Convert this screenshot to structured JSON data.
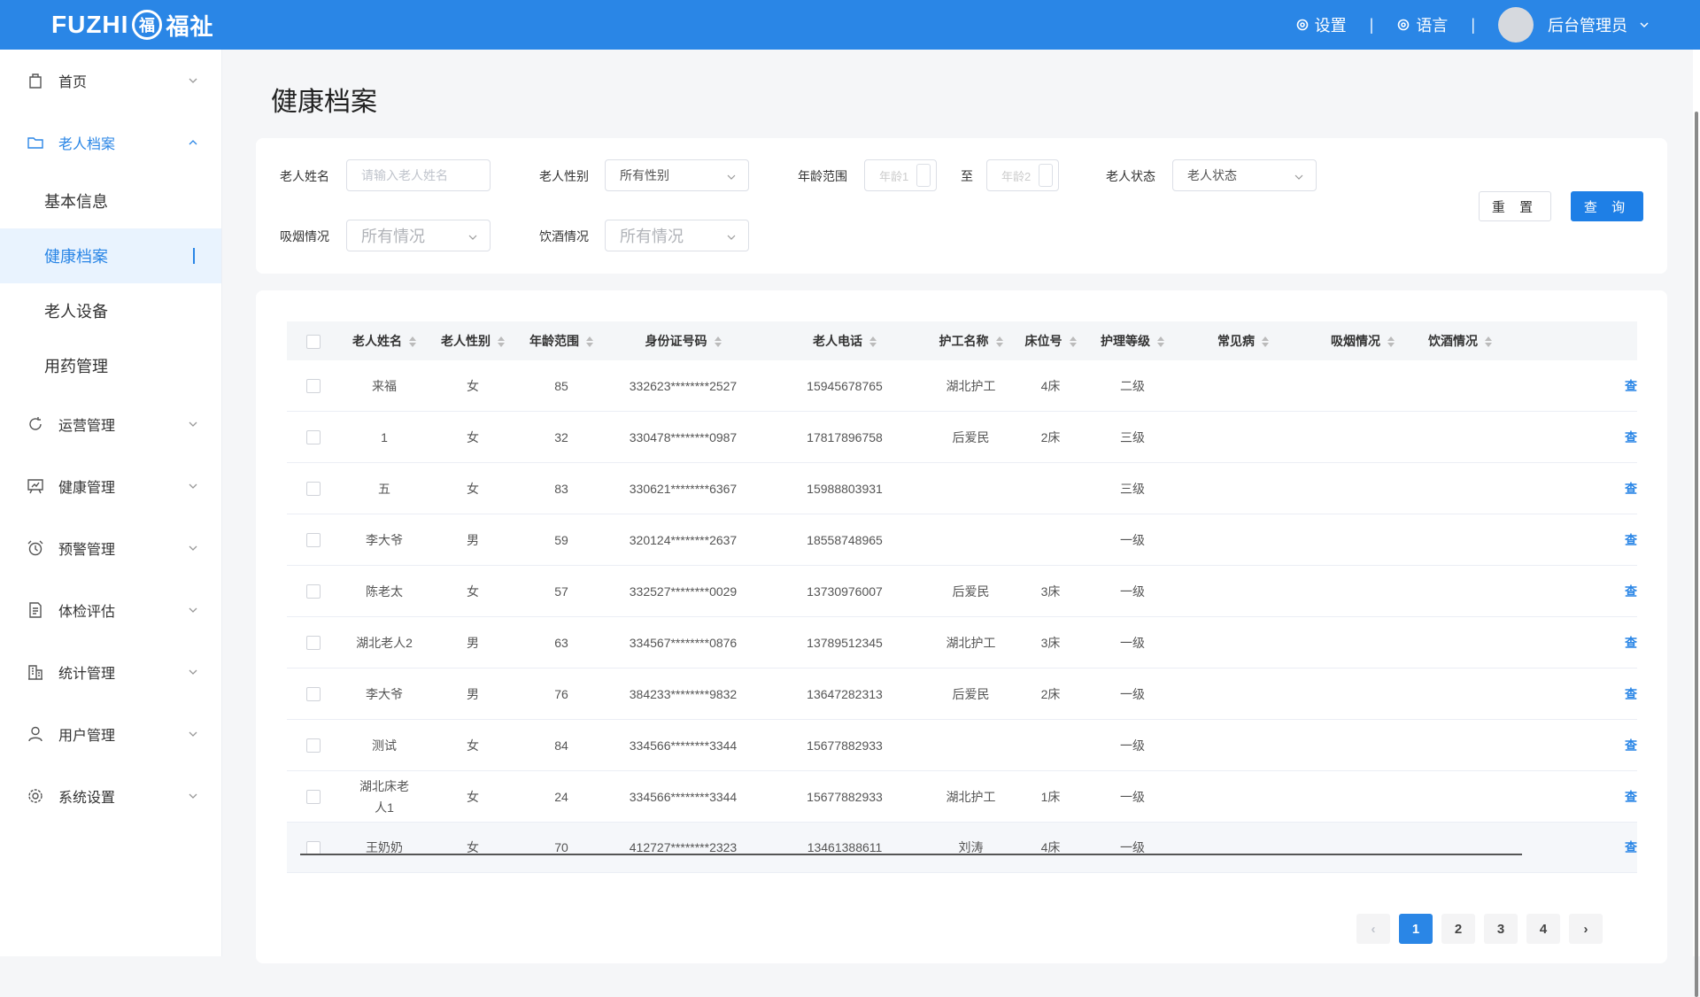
{
  "brand": {
    "text": "FUZHI",
    "mark": "福",
    "cn": "福祉"
  },
  "header": {
    "settings": "设置",
    "language": "语言",
    "user": "后台管理员",
    "sep": "|"
  },
  "sidebar": {
    "items": [
      {
        "label": "首页",
        "icon": "bag-icon",
        "open": false
      },
      {
        "label": "老人档案",
        "icon": "folder-icon",
        "open": true,
        "children": [
          {
            "label": "基本信息",
            "active": false
          },
          {
            "label": "健康档案",
            "active": true
          },
          {
            "label": "老人设备",
            "active": false
          },
          {
            "label": "用药管理",
            "active": false
          }
        ]
      },
      {
        "label": "运营管理",
        "icon": "refresh-icon"
      },
      {
        "label": "健康管理",
        "icon": "chart-board-icon"
      },
      {
        "label": "预警管理",
        "icon": "alarm-clock-icon"
      },
      {
        "label": "体检评估",
        "icon": "document-icon"
      },
      {
        "label": "统计管理",
        "icon": "building-icon"
      },
      {
        "label": "用户管理",
        "icon": "user-icon"
      },
      {
        "label": "系统设置",
        "icon": "gear-icon"
      }
    ]
  },
  "page": {
    "title": "健康档案"
  },
  "filters": {
    "name_label": "老人姓名",
    "name_placeholder": "请输入老人姓名",
    "gender_label": "老人性别",
    "gender_value": "所有性别",
    "age_label": "年龄范围",
    "age_from_placeholder": "年龄1",
    "age_to_label": "至",
    "age_to_placeholder": "年龄2",
    "status_label": "老人状态",
    "status_value": "老人状态",
    "smoke_label": "吸烟情况",
    "smoke_value": "所有情况",
    "drink_label": "饮酒情况",
    "drink_value": "所有情况",
    "reset": "重 置",
    "query": "查 询"
  },
  "table": {
    "columns": [
      "老人姓名",
      "老人性别",
      "年龄范围",
      "身份证号码",
      "老人电话",
      "护工名称",
      "床位号",
      "护理等级",
      "常见病",
      "吸烟情况",
      "饮酒情况"
    ],
    "action_label": "查",
    "rows": [
      [
        "来福",
        "女",
        "85",
        "332623********2527",
        "15945678765",
        "湖北护工",
        "4床",
        "二级",
        "",
        "",
        ""
      ],
      [
        "1",
        "女",
        "32",
        "330478********0987",
        "17817896758",
        "后爱民",
        "2床",
        "三级",
        "",
        "",
        ""
      ],
      [
        "五",
        "女",
        "83",
        "330621********6367",
        "15988803931",
        "",
        "",
        "三级",
        "",
        "",
        ""
      ],
      [
        "李大爷",
        "男",
        "59",
        "320124********2637",
        "18558748965",
        "",
        "",
        "一级",
        "",
        "",
        ""
      ],
      [
        "陈老太",
        "女",
        "57",
        "332527********0029",
        "13730976007",
        "后爱民",
        "3床",
        "一级",
        "",
        "",
        ""
      ],
      [
        "湖北老人2",
        "男",
        "63",
        "334567********0876",
        "13789512345",
        "湖北护工",
        "3床",
        "一级",
        "",
        "",
        ""
      ],
      [
        "李大爷",
        "男",
        "76",
        "384233********9832",
        "13647282313",
        "后爱民",
        "2床",
        "一级",
        "",
        "",
        ""
      ],
      [
        "测试",
        "女",
        "84",
        "334566********3344",
        "15677882933",
        "",
        "",
        "一级",
        "",
        "",
        ""
      ],
      [
        "湖北床老人1",
        "女",
        "24",
        "334566********3344",
        "15677882933",
        "湖北护工",
        "1床",
        "一级",
        "",
        "",
        ""
      ],
      [
        "王奶奶",
        "女",
        "70",
        "412727********2323",
        "13461388611",
        "刘涛",
        "4床",
        "一级",
        "",
        "",
        ""
      ]
    ]
  },
  "pagination": {
    "prev": "‹",
    "pages": [
      "1",
      "2",
      "3",
      "4"
    ],
    "current": "1",
    "next": "›"
  }
}
